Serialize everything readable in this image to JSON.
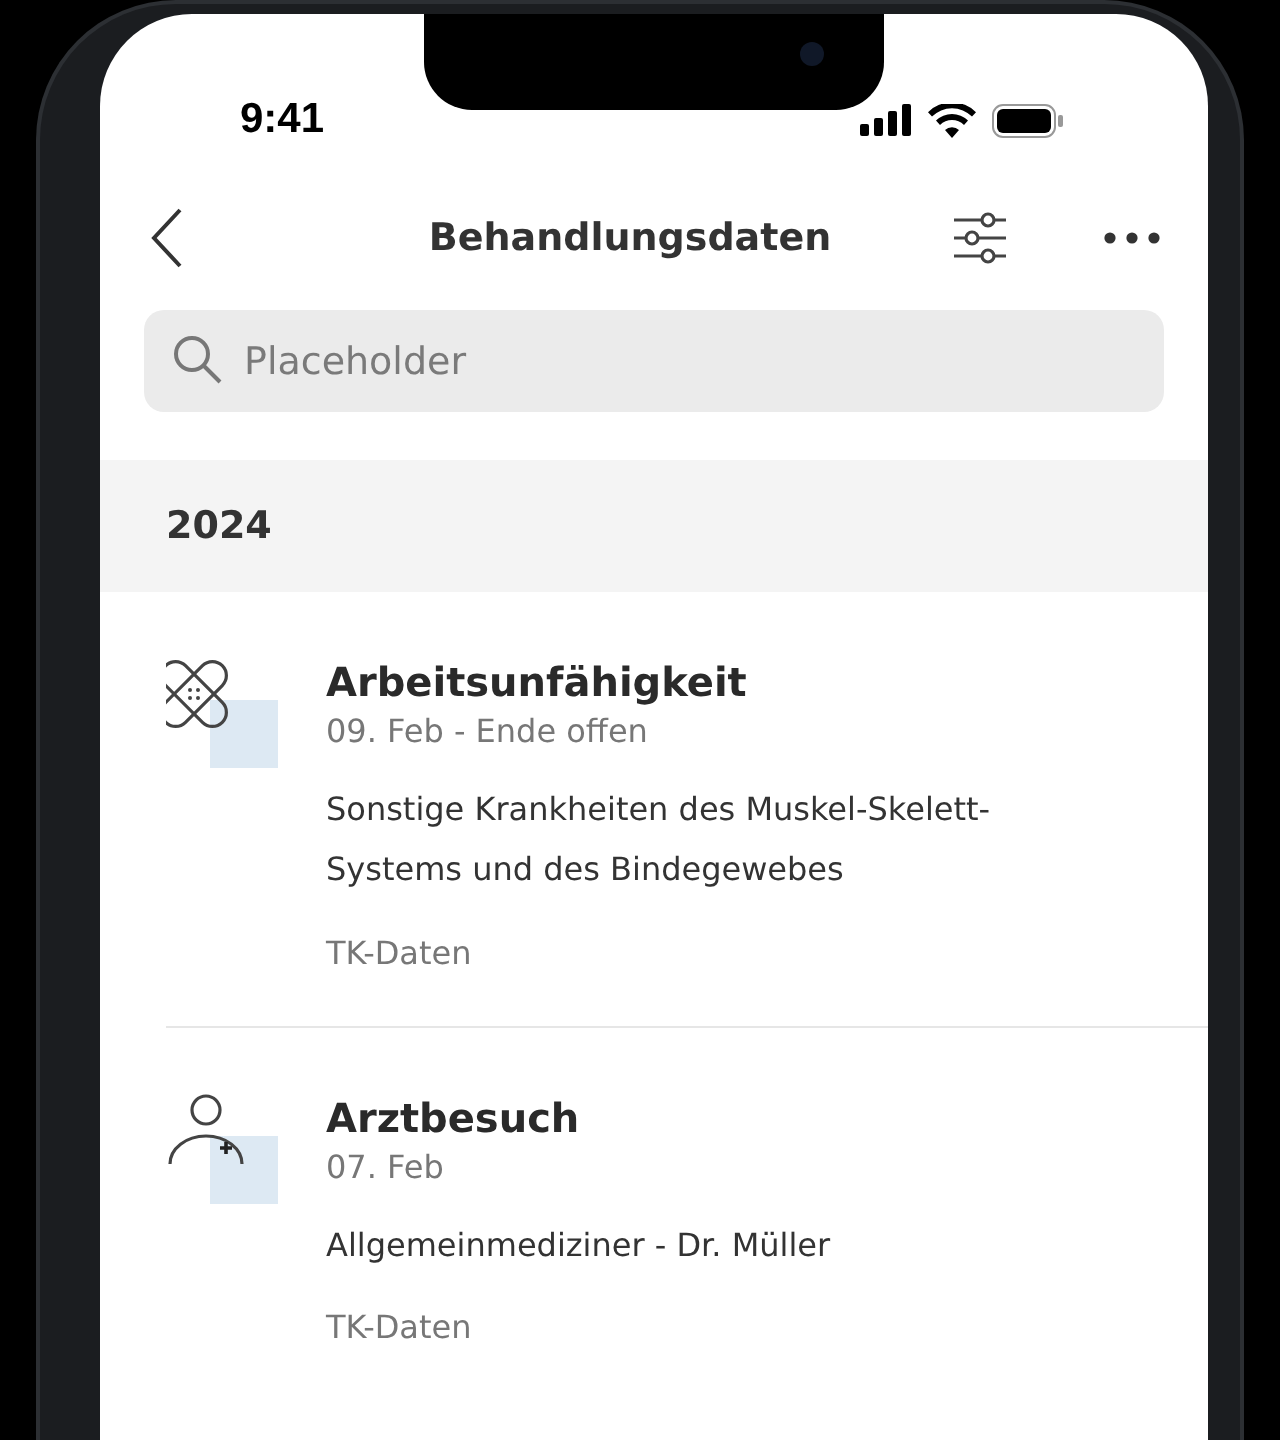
{
  "status_bar": {
    "time": "9:41"
  },
  "header": {
    "title": "Behandlungsdaten"
  },
  "search": {
    "placeholder": "Placeholder"
  },
  "section": {
    "title": "2024"
  },
  "entries": [
    {
      "kind": "sick-leave",
      "title": "Arbeitsunfähigkeit",
      "date": "09. Feb - Ende offen",
      "description": "Sonstige Krankheiten des Muskel-Skelett-Systems und des Bindegewebes",
      "source": "TK-Daten"
    },
    {
      "kind": "doctor-visit",
      "title": "Arztbesuch",
      "date": "07. Feb",
      "description": "Allgemeinmediziner - Dr. Müller",
      "source": "TK-Daten"
    }
  ]
}
